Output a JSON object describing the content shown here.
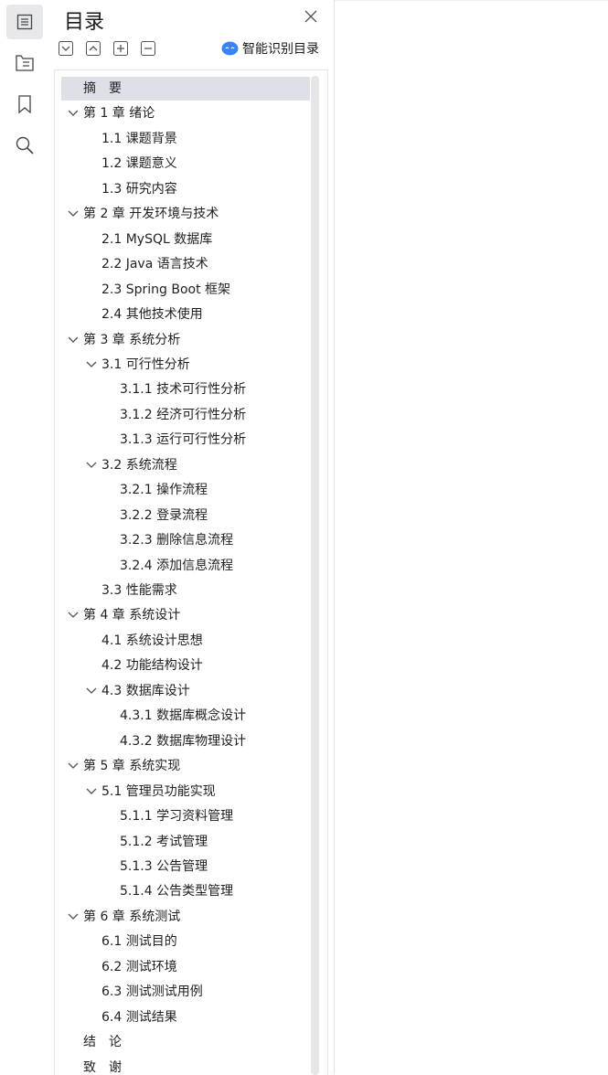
{
  "rail": {
    "items": [
      {
        "icon": "outline-icon",
        "active": true
      },
      {
        "icon": "attachment-tree-icon",
        "active": false
      },
      {
        "icon": "bookmark-icon",
        "active": false
      },
      {
        "icon": "search-icon",
        "active": false
      }
    ]
  },
  "panel": {
    "title": "目录",
    "smart_label": "智能识别目录",
    "toolbar": [
      "collapse-all-icon",
      "expand-all-icon",
      "add-icon",
      "remove-icon"
    ]
  },
  "toc": [
    {
      "text": "摘　要",
      "level": 0,
      "arrow": false,
      "selected": true
    },
    {
      "text": "第 1 章  绪论",
      "level": 0,
      "arrow": true
    },
    {
      "text": "1.1  课题背景",
      "level": 1,
      "arrow": false
    },
    {
      "text": "1.2  课题意义",
      "level": 1,
      "arrow": false
    },
    {
      "text": "1.3  研究内容",
      "level": 1,
      "arrow": false
    },
    {
      "text": "第 2 章  开发环境与技术",
      "level": 0,
      "arrow": true
    },
    {
      "text": "2.1 MySQL 数据库",
      "level": 1,
      "arrow": false
    },
    {
      "text": "2.2 Java 语言技术",
      "level": 1,
      "arrow": false
    },
    {
      "text": "2.3 Spring Boot 框架",
      "level": 1,
      "arrow": false
    },
    {
      "text": "2.4  其他技术使用",
      "level": 1,
      "arrow": false
    },
    {
      "text": "第 3 章  系统分析",
      "level": 0,
      "arrow": true
    },
    {
      "text": "3.1  可行性分析",
      "level": 1,
      "arrow": true
    },
    {
      "text": "3.1.1 技术可行性分析",
      "level": 2,
      "arrow": false
    },
    {
      "text": "3.1.2 经济可行性分析",
      "level": 2,
      "arrow": false
    },
    {
      "text": "3.1.3 运行可行性分析",
      "level": 2,
      "arrow": false
    },
    {
      "text": "3.2  系统流程",
      "level": 1,
      "arrow": true
    },
    {
      "text": "3.2.1  操作流程",
      "level": 2,
      "arrow": false
    },
    {
      "text": "3.2.2  登录流程",
      "level": 2,
      "arrow": false
    },
    {
      "text": "3.2.3  删除信息流程",
      "level": 2,
      "arrow": false
    },
    {
      "text": "3.2.4  添加信息流程",
      "level": 2,
      "arrow": false
    },
    {
      "text": "3.3  性能需求",
      "level": 1,
      "arrow": false
    },
    {
      "text": "第 4 章  系统设计",
      "level": 0,
      "arrow": true
    },
    {
      "text": "4.1  系统设计思想",
      "level": 1,
      "arrow": false
    },
    {
      "text": "4.2  功能结构设计",
      "level": 1,
      "arrow": false
    },
    {
      "text": "4.3  数据库设计",
      "level": 1,
      "arrow": true
    },
    {
      "text": "4.3.1  数据库概念设计",
      "level": 2,
      "arrow": false
    },
    {
      "text": "4.3.2  数据库物理设计",
      "level": 2,
      "arrow": false
    },
    {
      "text": "第 5 章  系统实现",
      "level": 0,
      "arrow": true
    },
    {
      "text": "5.1  管理员功能实现",
      "level": 1,
      "arrow": true
    },
    {
      "text": "5.1.1  学习资料管理",
      "level": 2,
      "arrow": false
    },
    {
      "text": "5.1.2  考试管理",
      "level": 2,
      "arrow": false
    },
    {
      "text": "5.1.3  公告管理",
      "level": 2,
      "arrow": false
    },
    {
      "text": "5.1.4  公告类型管理",
      "level": 2,
      "arrow": false
    },
    {
      "text": "第 6 章  系统测试",
      "level": 0,
      "arrow": true
    },
    {
      "text": "6.1 测试目的",
      "level": 1,
      "arrow": false
    },
    {
      "text": "6.2 测试环境",
      "level": 1,
      "arrow": false
    },
    {
      "text": "6.3 测试测试用例",
      "level": 1,
      "arrow": false
    },
    {
      "text": "6.4 测试结果",
      "level": 1,
      "arrow": false
    },
    {
      "text": "结　论",
      "level": 0,
      "arrow": false
    },
    {
      "text": "致　谢",
      "level": 0,
      "arrow": false
    }
  ],
  "colors": {
    "accent": "#3b82f6",
    "selected_bg": "#dde1e7"
  }
}
